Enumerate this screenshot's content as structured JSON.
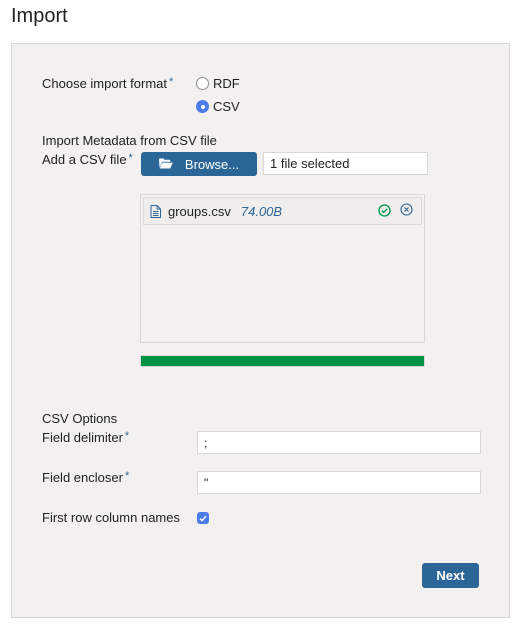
{
  "page": {
    "title": "Import"
  },
  "format": {
    "label": "Choose import format",
    "required_mark": "*",
    "options": [
      {
        "label": "RDF",
        "checked": false
      },
      {
        "label": "CSV",
        "checked": true
      }
    ]
  },
  "metadata": {
    "section_label": "Import Metadata from CSV file",
    "add_file_label": "Add a CSV file",
    "required_mark": "*",
    "browse_label": "Browse...",
    "browse_icon": "folder-open-icon",
    "file_status": "1 file selected"
  },
  "files": [
    {
      "name": "groups.csv",
      "size": "74.00B",
      "icon": "file-text-icon",
      "status_icon": "check-circle-icon",
      "remove_icon": "close-circle-icon"
    }
  ],
  "upload": {
    "progress_percent": 100,
    "color": "#009245"
  },
  "csv_options": {
    "section_label": "CSV Options",
    "delimiter_label": "Field delimiter",
    "delimiter_value": ";",
    "encloser_label": "Field encloser",
    "encloser_value": "\"",
    "required_mark": "*",
    "first_row_label": "First row column names",
    "first_row_checked": true
  },
  "actions": {
    "next_label": "Next"
  },
  "colors": {
    "primary": "#2c6699",
    "accent": "#4a7de9",
    "success": "#009245"
  }
}
